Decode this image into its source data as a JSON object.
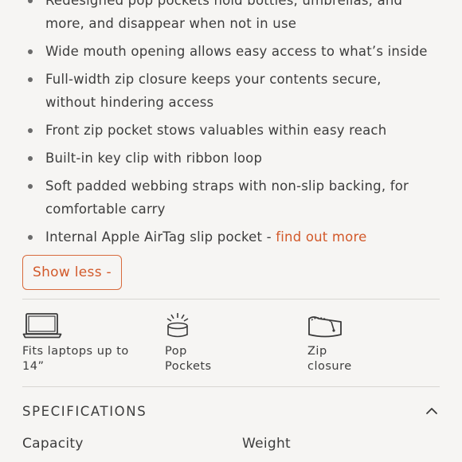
{
  "features": [
    {
      "lines": [
        "Redesigned pop pockets hold bottles, umbrellas, and",
        "more, and disappear when not in use"
      ]
    },
    {
      "lines": [
        "Wide mouth opening allows easy access to what’s inside"
      ]
    },
    {
      "lines": [
        "Full-width zip closure keeps your contents secure,",
        "without hindering access"
      ]
    },
    {
      "lines": [
        "Front zip pocket stows valuables within easy reach"
      ]
    },
    {
      "lines": [
        "Built-in key clip with ribbon loop"
      ]
    },
    {
      "lines": [
        "Soft padded webbing straps with non-slip backing, for",
        "comfortable carry"
      ]
    }
  ],
  "airtag": {
    "text": "Internal Apple AirTag slip pocket - ",
    "link": "find out more"
  },
  "show_less_label": "Show less -",
  "icon_features": [
    {
      "icon": "laptop-icon",
      "line1": "Fits laptops up to",
      "line2": "14”"
    },
    {
      "icon": "pop-pocket-icon",
      "line1": "Pop",
      "line2": "Pockets"
    },
    {
      "icon": "zip-closure-icon",
      "line1": "Zip",
      "line2": "closure"
    }
  ],
  "specifications": {
    "title": "SPECIFICATIONS",
    "expanded": true,
    "col1": "Capacity",
    "col2": "Weight"
  },
  "colors": {
    "accent": "#d2592a",
    "text": "#3d3d3d",
    "background": "#f6f5f3"
  }
}
